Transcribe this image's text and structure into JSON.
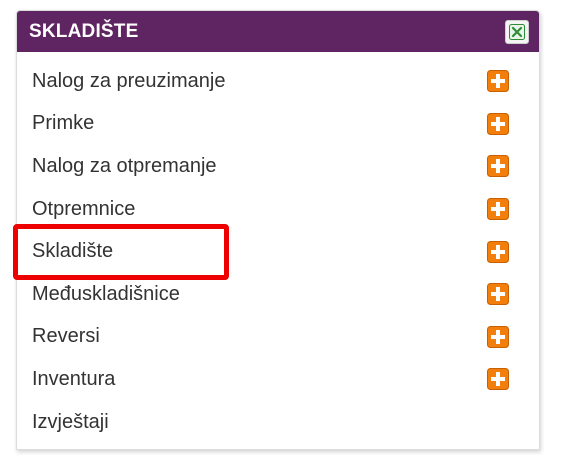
{
  "panel": {
    "title": "SKLADIŠTE",
    "close_icon": "close-icon"
  },
  "menu": {
    "items": [
      {
        "label": "Nalog za preuzimanje",
        "has_add": true
      },
      {
        "label": "Primke",
        "has_add": true
      },
      {
        "label": "Nalog za otpremanje",
        "has_add": true
      },
      {
        "label": "Otpremnice",
        "has_add": true
      },
      {
        "label": "Skladište",
        "has_add": true
      },
      {
        "label": "Međuskladišnice",
        "has_add": true
      },
      {
        "label": "Reversi",
        "has_add": true
      },
      {
        "label": "Inventura",
        "has_add": true
      },
      {
        "label": "Izvještaji",
        "has_add": false
      }
    ]
  },
  "highlight": {
    "target": "Skladište",
    "color": "#ee0000"
  },
  "colors": {
    "header": "#5f2462",
    "add_icon_orange": "#f27f0c",
    "close_green": "#2e8b3a"
  }
}
